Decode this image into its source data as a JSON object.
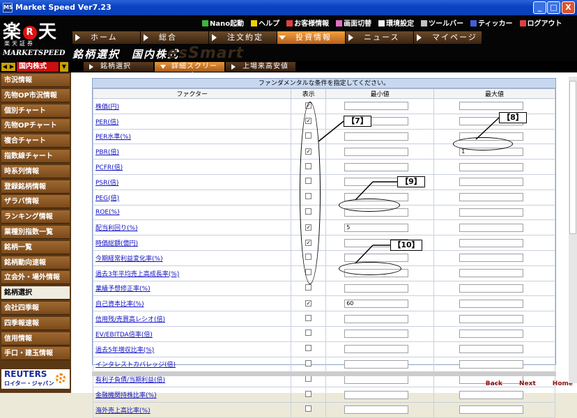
{
  "window": {
    "title": "Market Speed Ver7.23",
    "icon": "app-icon"
  },
  "logo": {
    "brand_left": "楽",
    "brand_mark": "R",
    "brand_right": "天",
    "securities": "楽天証券",
    "product": "MARKETSPEED"
  },
  "util_links": [
    {
      "label": "Nano起動",
      "icon": "nano-icon",
      "color": "#3cb83c"
    },
    {
      "label": "ヘルプ",
      "icon": "help-icon",
      "color": "#f0d000"
    },
    {
      "label": "お客様情報",
      "icon": "user-icon",
      "color": "#e04040"
    },
    {
      "label": "画面切替",
      "icon": "switch-icon",
      "color": "#e070c0"
    },
    {
      "label": "環境設定",
      "icon": "settings-icon",
      "color": "#f0f0f0"
    },
    {
      "label": "ツールバー",
      "icon": "toolbar-icon",
      "color": "#c0c0c0"
    },
    {
      "label": "ティッカー",
      "icon": "ticker-icon",
      "color": "#4060e0"
    },
    {
      "label": "ログアウト",
      "icon": "logout-icon",
      "color": "#e04040"
    }
  ],
  "nav_tabs": [
    {
      "label": "ホーム"
    },
    {
      "label": "総合"
    },
    {
      "label": "注文約定"
    },
    {
      "label": "投資情報",
      "active": true
    },
    {
      "label": "ニュース"
    },
    {
      "label": "マイページ"
    }
  ],
  "page_title": "銘柄選択　国内株式",
  "page_bg_word": "esSmart",
  "market_selector": {
    "value": "国内株式"
  },
  "sub_tabs": [
    {
      "label": "銘柄選択"
    },
    {
      "label": "詳細スクリーニング",
      "active": true
    },
    {
      "label": "上場来高安値"
    }
  ],
  "sidebar": {
    "items": [
      "市況情報",
      "先物OP市況情報",
      "個別チャート",
      "先物OPチャート",
      "複合チャート",
      "指数線チャート",
      "時系列情報",
      "登録銘柄情報",
      "ザラバ情報",
      "ランキング情報",
      "業種別指数一覧",
      "銘柄一覧",
      "銘柄動向速報",
      "立会外・場外情報",
      "銘柄選択",
      "会社四季報",
      "四季報速報",
      "信用情報",
      "手口・建玉情報"
    ],
    "active_index": 14
  },
  "reuters": {
    "name": "REUTERS",
    "sub": "ロイター・ジャパン"
  },
  "form": {
    "header": "ファンダメンタルな条件を指定してください。",
    "columns": [
      "ファクター",
      "表示",
      "最小値",
      "最大値"
    ],
    "rows": [
      {
        "factor": "株価(円)",
        "checked": true,
        "min": "",
        "max": ""
      },
      {
        "factor": "PER(倍)",
        "checked": true,
        "min": "",
        "max": ""
      },
      {
        "factor": "PER水準(%)",
        "checked": false,
        "min": "",
        "max": ""
      },
      {
        "factor": "PBR(倍)",
        "checked": true,
        "min": "",
        "max": "1"
      },
      {
        "factor": "PCFR(倍)",
        "checked": false,
        "min": "",
        "max": ""
      },
      {
        "factor": "PSR(倍)",
        "checked": false,
        "min": "",
        "max": ""
      },
      {
        "factor": "PEG(倍)",
        "checked": false,
        "min": "",
        "max": ""
      },
      {
        "factor": "ROE(%)",
        "checked": false,
        "min": "",
        "max": ""
      },
      {
        "factor": "配当利回り(%)",
        "checked": true,
        "min": "5",
        "max": ""
      },
      {
        "factor": "時価総額(億円)",
        "checked": true,
        "min": "",
        "max": ""
      },
      {
        "factor": "今期経常利益変化率(%)",
        "checked": false,
        "min": "",
        "max": ""
      },
      {
        "factor": "過去3年平均売上高成長率(%)",
        "checked": false,
        "min": "",
        "max": ""
      },
      {
        "factor": "業績予想修正率(%)",
        "checked": false,
        "min": "",
        "max": ""
      },
      {
        "factor": "自己資本比率(%)",
        "checked": true,
        "min": "60",
        "max": ""
      },
      {
        "factor": "信用残/売買高レシオ(倍)",
        "checked": false,
        "min": "",
        "max": ""
      },
      {
        "factor": "EV/EBITDA倍率(倍)",
        "checked": false,
        "min": "",
        "max": ""
      },
      {
        "factor": "過去5年増収比率(%)",
        "checked": false,
        "min": "",
        "max": ""
      },
      {
        "factor": "インタレストカバレッジ(倍)",
        "checked": false,
        "min": "",
        "max": ""
      },
      {
        "factor": "有利子負債/当期利益(倍)",
        "checked": false,
        "min": "",
        "max": ""
      },
      {
        "factor": "金融機関持株比率(%)",
        "checked": false,
        "min": "",
        "max": ""
      },
      {
        "factor": "海外売上高比率(%)",
        "checked": false,
        "min": "",
        "max": ""
      }
    ]
  },
  "footer_nav": [
    "Back",
    "Next",
    "Home"
  ],
  "annotations": [
    "【7】",
    "【8】",
    "【9】",
    "【10】"
  ],
  "window_buttons": {
    "minimize": "_",
    "maximize": "□",
    "close": "X"
  }
}
